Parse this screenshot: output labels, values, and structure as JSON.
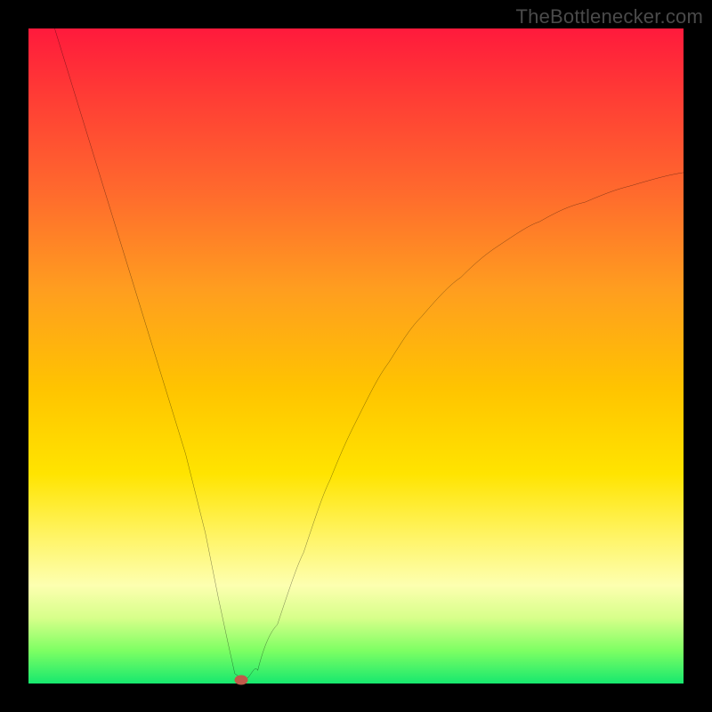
{
  "attribution": "TheBottlenecker.com",
  "chart_data": {
    "type": "line",
    "title": "",
    "xlabel": "",
    "ylabel": "",
    "xlim": [
      0,
      100
    ],
    "ylim": [
      0,
      100
    ],
    "gradient_colors": {
      "top": "#ff1a3c",
      "upper_mid": "#ff9e1f",
      "mid": "#ffe400",
      "lower_mid": "#fdffb0",
      "bottom": "#17e86e"
    },
    "series": [
      {
        "name": "bottleneck-curve",
        "x": [
          4,
          8,
          12,
          16,
          20,
          24,
          27,
          29,
          30.5,
          31.5,
          33,
          35,
          38,
          42,
          46,
          50,
          55,
          60,
          66,
          72,
          78,
          85,
          92,
          100
        ],
        "y": [
          100,
          87,
          74,
          61,
          48,
          35,
          23,
          13,
          6,
          1.5,
          0.5,
          2,
          9,
          20,
          31,
          40,
          49,
          56,
          62,
          67,
          70.5,
          73.5,
          76,
          78
        ]
      }
    ],
    "optimal_marker": {
      "x": 32.5,
      "y": 0.6
    },
    "annotations": []
  }
}
